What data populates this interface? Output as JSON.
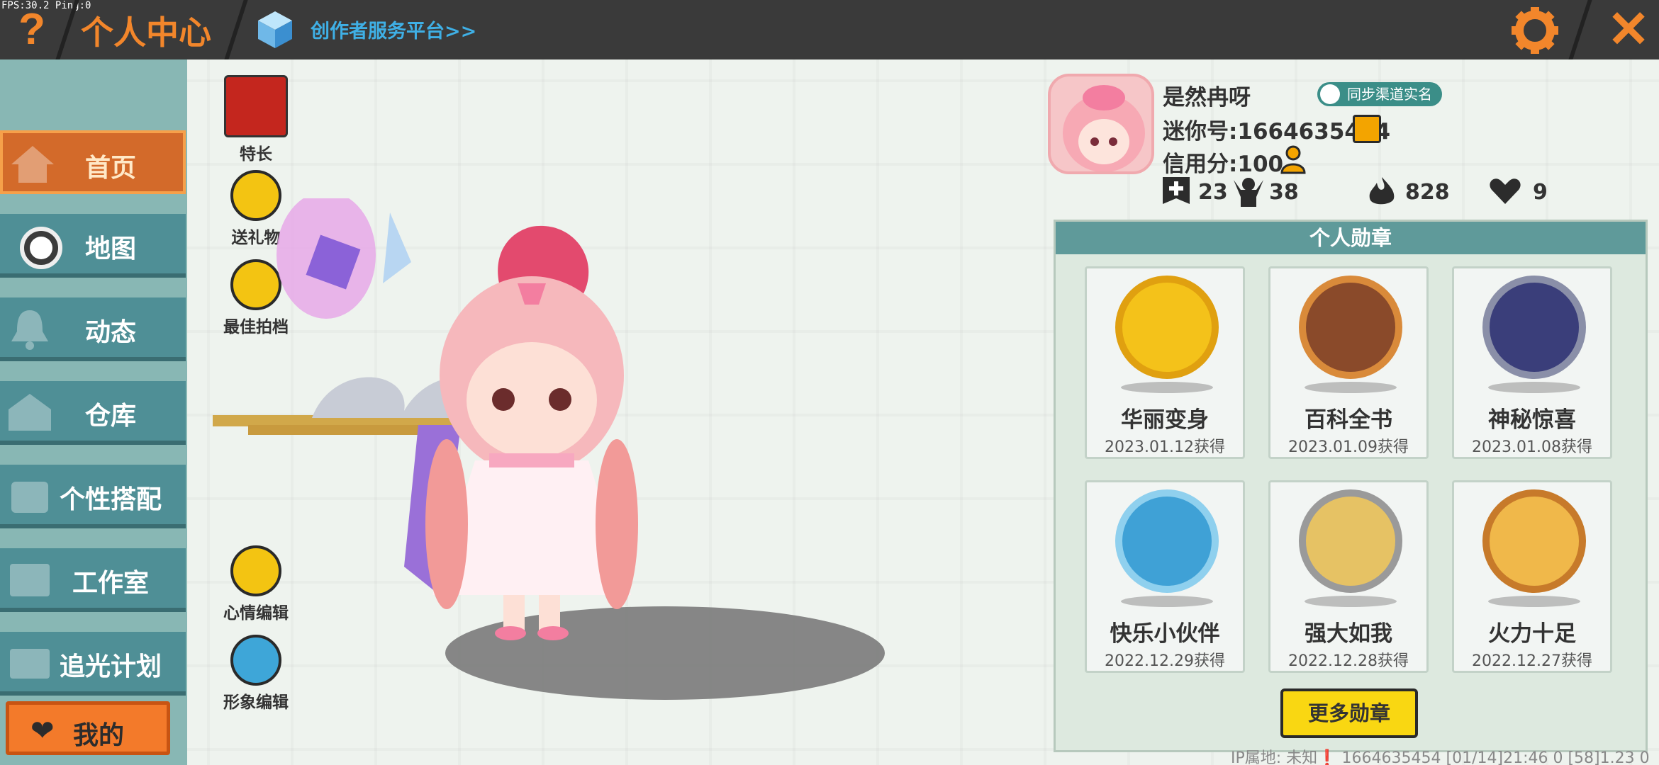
{
  "debug": {
    "fps": "FPS:30.2  Ping:0"
  },
  "header": {
    "help_label": "?",
    "title": "个人中心",
    "creator_link": "创作者服务平台>>",
    "close_label": "✕"
  },
  "sidebar": {
    "items": [
      {
        "label": "首页",
        "icon": "house-icon",
        "active": true
      },
      {
        "label": "地图",
        "icon": "map-icon"
      },
      {
        "label": "动态",
        "icon": "bell-icon"
      },
      {
        "label": "仓库",
        "icon": "warehouse-icon"
      },
      {
        "label": "个性搭配",
        "icon": "outfit-icon"
      },
      {
        "label": "工作室",
        "icon": "studio-icon"
      },
      {
        "label": "追光计划",
        "icon": "spotlight-icon"
      }
    ],
    "mine_label": "我的"
  },
  "actions": {
    "specialty": "特长",
    "gift": "送礼物",
    "best_partner": "最佳拍档",
    "mood_edit": "心情编辑",
    "appearance_edit": "形象编辑"
  },
  "profile": {
    "nickname": "是然冉呀",
    "sync_label": "同步渠道实名",
    "mini_id": "迷你号:1664635454",
    "credit": "信用分:100",
    "stats": {
      "add": "23",
      "fans": "38",
      "hot": "828",
      "likes": "9"
    }
  },
  "badges": {
    "title": "个人勋章",
    "items": [
      {
        "name": "华丽变身",
        "date": "2023.01.12获得",
        "color": "#f4c21a"
      },
      {
        "name": "百科全书",
        "date": "2023.01.09获得",
        "color": "#d98a3a"
      },
      {
        "name": "神秘惊喜",
        "date": "2023.01.08获得",
        "color": "#5b6aa8"
      },
      {
        "name": "快乐小伙伴",
        "date": "2022.12.29获得",
        "color": "#46a9d8"
      },
      {
        "name": "强大如我",
        "date": "2022.12.28获得",
        "color": "#9a9a9a"
      },
      {
        "name": "火力十足",
        "date": "2022.12.27获得",
        "color": "#e88a3a"
      }
    ],
    "more_label": "更多勋章"
  },
  "footer": {
    "text": "IP属地: 未知❗   1664635454   [01/14]21:46 0  [58]1.23 0"
  },
  "colors": {
    "accent_orange": "#f2862b",
    "nav_teal": "#4f8f96",
    "panel_header": "#5f9a9a"
  }
}
